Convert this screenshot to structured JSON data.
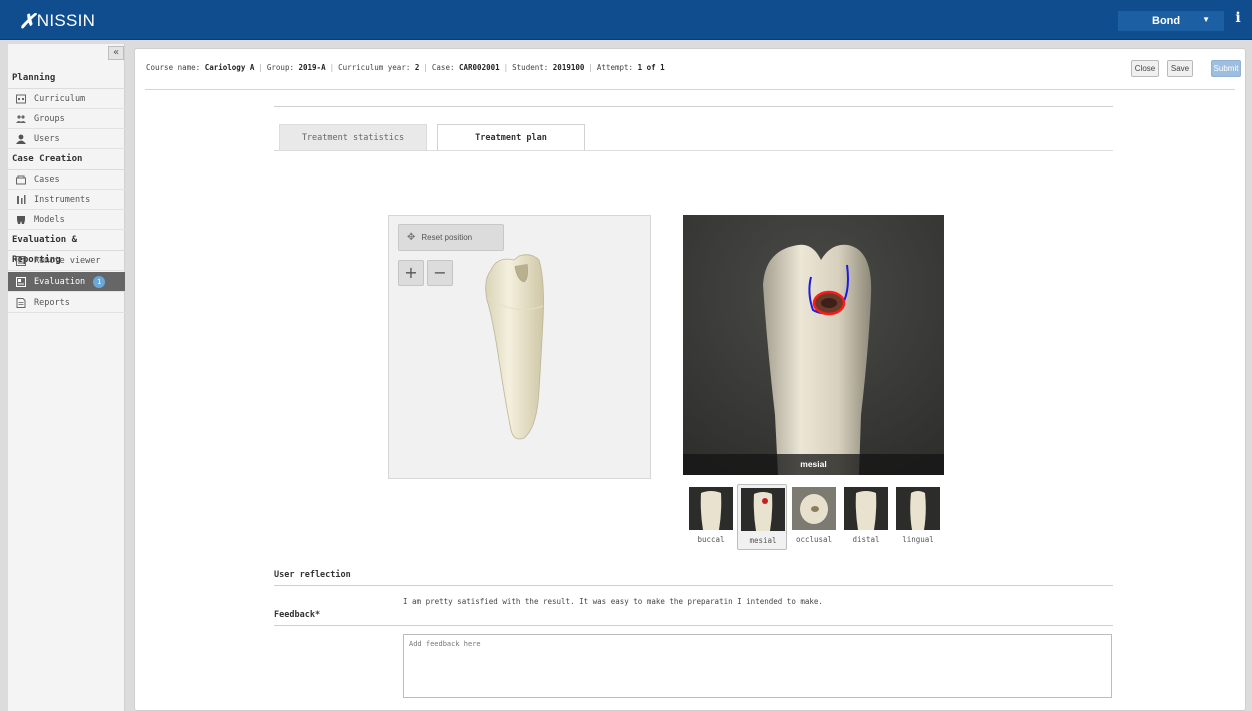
{
  "app": {
    "brand": "NISSIN"
  },
  "header": {
    "user": "Bond",
    "info_icon": "i"
  },
  "sidebar": {
    "collapse_icon": "«",
    "sections": [
      {
        "title": "Planning",
        "items": [
          {
            "label": "Curriculum",
            "icon": "calendar-icon"
          },
          {
            "label": "Groups",
            "icon": "groups-icon"
          },
          {
            "label": "Users",
            "icon": "user-icon"
          }
        ]
      },
      {
        "title": "Case Creation",
        "items": [
          {
            "label": "Cases",
            "icon": "cases-icon"
          },
          {
            "label": "Instruments",
            "icon": "instruments-icon"
          },
          {
            "label": "Models",
            "icon": "tooth-icon"
          }
        ]
      },
      {
        "title": "Evaluation & Reporting",
        "items": [
          {
            "label": "Remote viewer",
            "icon": "monitor-icon"
          },
          {
            "label": "Evaluation",
            "icon": "evaluation-icon",
            "badge": "1",
            "active": true
          },
          {
            "label": "Reports",
            "icon": "report-icon"
          }
        ]
      }
    ]
  },
  "breadcrumb": {
    "course_label": "Course name:",
    "course": "Cariology A",
    "group_label": "Group:",
    "group": "2019-A",
    "year_label": "Curriculum year:",
    "year": "2",
    "case_label": "Case:",
    "case": "CAR002001",
    "student_label": "Student:",
    "student": "2019100",
    "attempt_label": "Attempt:",
    "attempt": "1 of 1"
  },
  "toolbar": {
    "close_label": "Close",
    "save_label": "Save",
    "submit_label": "Submit"
  },
  "tabs": [
    {
      "label": "Treatment statistics",
      "active": false
    },
    {
      "label": "Treatment plan",
      "active": true
    }
  ],
  "viewer": {
    "reset_label": "Reset position",
    "zoom_in": "+",
    "zoom_out": "−"
  },
  "photo": {
    "caption": "mesial"
  },
  "thumbnails": [
    "buccal",
    "mesial",
    "occlusal",
    "distal",
    "lingual"
  ],
  "selected_thumbnail": "mesial",
  "reflection": {
    "label": "User reflection",
    "text": "I am pretty satisfied with the result. It was easy to make the preparatin I intended to make."
  },
  "feedback": {
    "label": "Feedback*",
    "placeholder": "Add feedback here"
  },
  "colors": {
    "topbar": "#0f4d8f",
    "active_item": "#666666",
    "badge": "#69a8d8",
    "submit": "#9dbedf"
  }
}
